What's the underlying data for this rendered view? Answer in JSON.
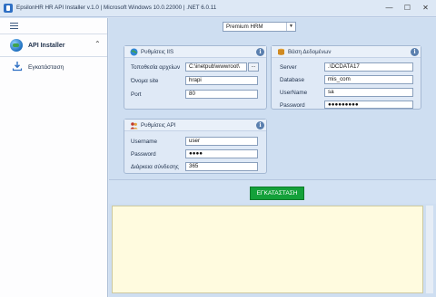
{
  "window": {
    "title": "EpsilonHR HR API Installer v.1.0 | Microsoft Windows 10.0.22000 | .NET 6.0.11",
    "minimize": "—",
    "maximize": "☐",
    "close": "✕"
  },
  "sidebar": {
    "menu_icon": "hamburger-icon",
    "group": {
      "label": "API Installer",
      "icon": "globe-icon",
      "collapse_glyph": "⌃"
    },
    "items": [
      {
        "label": "Εγκατάσταση",
        "icon": "download-icon"
      }
    ]
  },
  "edition": {
    "value": "Premium HRM",
    "arrow": "▼"
  },
  "iis_panel": {
    "title": "Ρυθμίσεις IIS",
    "info": "i",
    "fields": [
      {
        "label": "Τοποθεσία αρχείων",
        "value": "C:\\inetpub\\wwwroot\\"
      },
      {
        "label": "Όνομα site",
        "value": "hrapi"
      },
      {
        "label": "Port",
        "value": "80"
      }
    ],
    "browse_label": "..."
  },
  "db_panel": {
    "title": "Βάση Δεδομένων",
    "info": "i",
    "fields": [
      {
        "label": "Server",
        "value": ".\\DCDATA17"
      },
      {
        "label": "Database",
        "value": "mis_com"
      },
      {
        "label": "UserName",
        "value": "sa"
      },
      {
        "label": "Password",
        "value": "●●●●●●●●●"
      }
    ]
  },
  "api_panel": {
    "title": "Ρυθμίσεις API",
    "info": "i",
    "fields": [
      {
        "label": "Username",
        "value": "user"
      },
      {
        "label": "Password",
        "value": "●●●●"
      },
      {
        "label": "Διάρκεια σύνδεσης",
        "value": "365"
      }
    ]
  },
  "install_button": "ΕΓΚΑΤΑΣΤΑΣΗ",
  "log": {
    "text": ""
  },
  "colors": {
    "accent": "#14a13a",
    "log_background": "#fffbdf",
    "window_background": "#cedef1"
  }
}
